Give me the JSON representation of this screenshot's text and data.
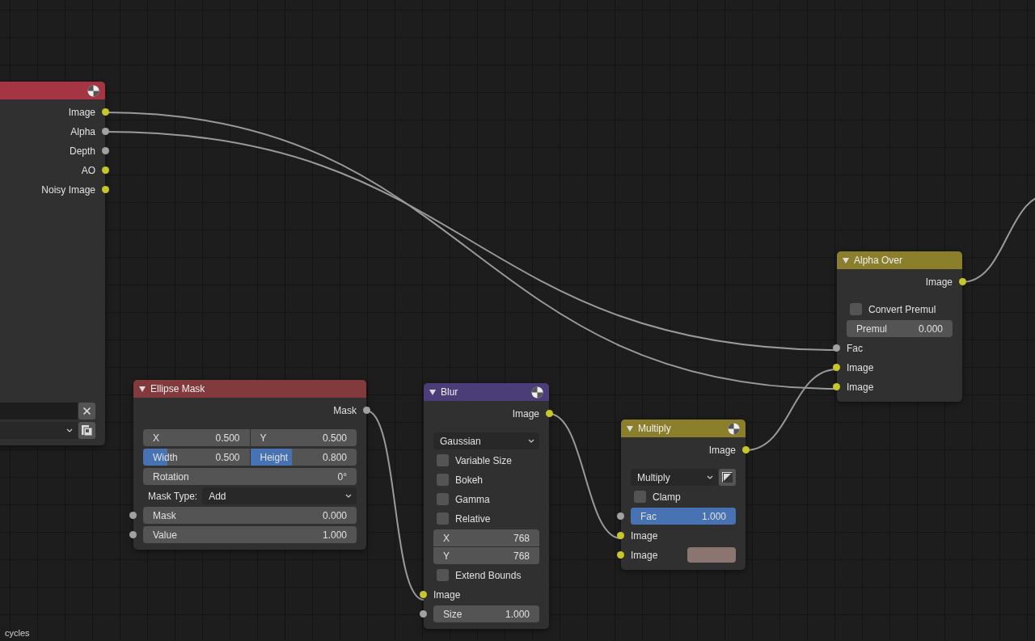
{
  "nodes": [
    {
      "color": "#a63543",
      "preview_icon": true,
      "rows": [
        {
          "kind": "output",
          "label": "Image",
          "socket": {
            "color": "#c7c729"
          }
        },
        {
          "kind": "output",
          "label": "Alpha",
          "socket": {
            "color": "#a1a1a1"
          }
        },
        {
          "kind": "output",
          "label": "Depth",
          "socket": {
            "color": "#a1a1a1"
          }
        },
        {
          "kind": "output",
          "label": "AO",
          "socket": {
            "color": "#c7c729"
          }
        },
        {
          "kind": "output",
          "label": "Noisy Image",
          "socket": {
            "color": "#c7c729"
          }
        },
        {
          "kind": "spacer"
        },
        {
          "kind": "spacer"
        },
        {
          "kind": "spacer"
        },
        {
          "kind": "spacer"
        },
        {
          "kind": "spacer"
        },
        {
          "kind": "spacer"
        },
        {
          "kind": "spacer"
        },
        {
          "kind": "spacer"
        },
        {
          "kind": "spacer"
        },
        {
          "kind": "spacer"
        },
        {
          "kind": "text_field"
        },
        {
          "kind": "layer_dropdown"
        }
      ]
    },
    {
      "title": "Ellipse Mask",
      "color": "#833a3c",
      "preview_icon": false,
      "rows": [
        {
          "kind": "output",
          "label": "Mask",
          "socket": {
            "color": "#a1a1a1"
          }
        },
        {
          "kind": "pair",
          "fields": [
            {
              "label": "X",
              "value": "0.500"
            },
            {
              "label": "Y",
              "value": "0.500"
            }
          ]
        },
        {
          "kind": "pair",
          "fields": [
            {
              "label": "Width",
              "value": "0.500",
              "level": 0.23
            },
            {
              "label": "Height",
              "value": "0.800",
              "level": 0.39
            }
          ]
        },
        {
          "kind": "field",
          "label": "Rotation",
          "value": "0°"
        },
        {
          "kind": "dropdown",
          "label": "Mask Type:",
          "value": "Add"
        },
        {
          "kind": "field",
          "label": "Mask",
          "value": "0.000",
          "socket": {
            "color": "#a1a1a1"
          }
        },
        {
          "kind": "field",
          "label": "Value",
          "value": "1.000",
          "socket": {
            "color": "#a1a1a1"
          }
        }
      ]
    },
    {
      "title": "Blur",
      "color": "#4b3e78",
      "preview_icon": true,
      "rows": [
        {
          "kind": "output",
          "label": "Image",
          "socket": {
            "color": "#c7c729"
          }
        },
        {
          "kind": "dropdown",
          "value": "Gaussian"
        },
        {
          "kind": "checkbox",
          "label": "Variable Size",
          "checked": false
        },
        {
          "kind": "checkbox",
          "label": "Bokeh",
          "checked": false
        },
        {
          "kind": "checkbox",
          "label": "Gamma",
          "checked": false
        },
        {
          "kind": "checkbox",
          "label": "Relative",
          "checked": false
        },
        {
          "kind": "stack",
          "fields": [
            {
              "label": "X",
              "value": "768"
            },
            {
              "label": "Y",
              "value": "768"
            }
          ]
        },
        {
          "kind": "checkbox",
          "label": "Extend Bounds",
          "checked": false
        },
        {
          "kind": "input",
          "label": "Image",
          "socket": {
            "color": "#c7c729"
          }
        },
        {
          "kind": "field",
          "label": "Size",
          "value": "1.000",
          "socket": {
            "color": "#a1a1a1"
          }
        }
      ]
    },
    {
      "title": "Multiply",
      "color": "#8b7f2c",
      "preview_icon": true,
      "rows": [
        {
          "kind": "output",
          "label": "Image",
          "socket": {
            "color": "#c7c729"
          }
        },
        {
          "kind": "blend_dropdown",
          "value": "Multiply"
        },
        {
          "kind": "checkbox",
          "label": "Clamp",
          "checked": false
        },
        {
          "kind": "field",
          "label": "Fac",
          "value": "1.000",
          "level": 1,
          "socket": {
            "color": "#a1a1a1"
          }
        },
        {
          "kind": "input",
          "label": "Image",
          "socket": {
            "color": "#c7c729"
          }
        },
        {
          "kind": "color_input",
          "label": "Image",
          "socket": {
            "color": "#c7c729"
          },
          "color": "#8a7570"
        }
      ]
    },
    {
      "title": "Alpha Over",
      "color": "#8b7f2c",
      "preview_icon": false,
      "rows": [
        {
          "kind": "output",
          "label": "Image",
          "socket": {
            "color": "#c7c729"
          }
        },
        {
          "kind": "checkbox",
          "label": "Convert Premul",
          "checked": false
        },
        {
          "kind": "field",
          "label": "Premul",
          "value": "0.000"
        },
        {
          "kind": "input",
          "label": "Fac",
          "socket": {
            "color": "#a1a1a1"
          }
        },
        {
          "kind": "input",
          "label": "Image",
          "socket": {
            "color": "#c7c729"
          }
        },
        {
          "kind": "input",
          "label": "Image",
          "socket": {
            "color": "#c7c729"
          }
        }
      ]
    }
  ],
  "status": "cycles"
}
